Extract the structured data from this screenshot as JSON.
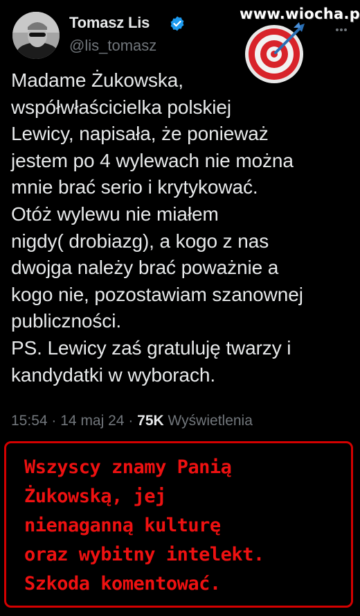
{
  "watermark": {
    "text": "www.wiocha.pl"
  },
  "tweet": {
    "author_name": "Tomasz Lis",
    "author_handle": "@lis_tomasz",
    "verified": true,
    "body": "Madame Żukowska,\nwspółwłaścicielka polskiej\nLewicy, napisała, że ponieważ\njestem po 4 wylewach nie można\nmnie brać serio i krytykować.\nOtóż wylewu nie miałem\nnigdy( drobiazg), a kogo z nas\ndwojga należy  brać poważnie a\nkogo nie, pozostawiam szanownej\npubliczności.\nPS. Lewicy zaś gratuluję twarzy i\nkandydatki w wyborach.",
    "time": "15:54",
    "date": "14 maj 24",
    "views_count": "75K",
    "views_label": "Wyświetlenia",
    "separator": "·"
  },
  "comment": {
    "text": "Wszyscy znamy Panią\nŻukowską, jej\nnienaganną kulturę\noraz wybitny intelekt.\nSzkoda komentować."
  },
  "colors": {
    "background": "#000000",
    "text_primary": "#e7e9ea",
    "text_secondary": "#71767b",
    "verified_badge": "#1d9bf0",
    "comment_text": "#ee1111",
    "comment_border": "#d40000"
  },
  "icons": [
    "verified-badge-icon",
    "more-options-icon",
    "target-dart-icon"
  ]
}
